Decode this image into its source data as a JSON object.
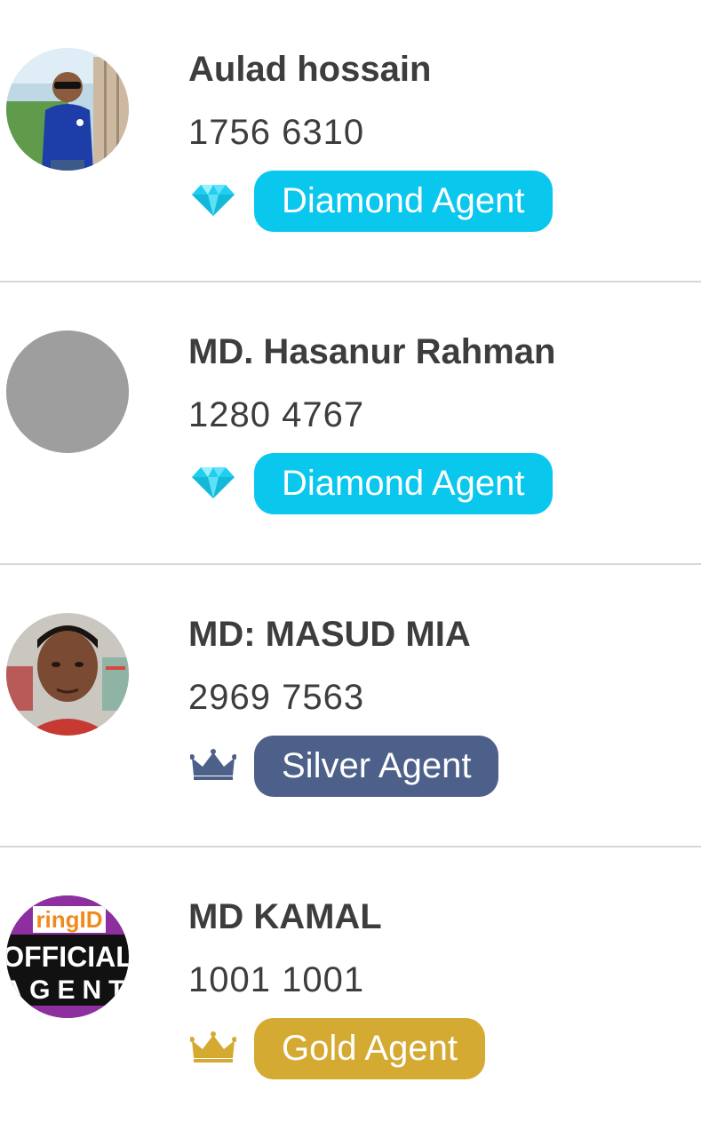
{
  "agents": [
    {
      "name": "Aulad hossain",
      "number": "1756 6310",
      "tier": "Diamond Agent",
      "icon": "diamond-icon",
      "badge_color": "#0ac7ee"
    },
    {
      "name": "MD. Hasanur Rahman",
      "number": "1280 4767",
      "tier": "Diamond Agent",
      "icon": "diamond-icon",
      "badge_color": "#0ac7ee"
    },
    {
      "name": "MD: MASUD MIA",
      "number": "2969 7563",
      "tier": "Silver Agent",
      "icon": "crown-icon",
      "badge_color": "#4d6089"
    },
    {
      "name": "MD KAMAL",
      "number": "1001 1001",
      "tier": "Gold Agent",
      "icon": "crown-icon",
      "badge_color": "#d5aa32"
    }
  ],
  "avatar4_text": {
    "line1": "ringID",
    "line2": "OFFICIAL",
    "line3": "AGENT"
  }
}
